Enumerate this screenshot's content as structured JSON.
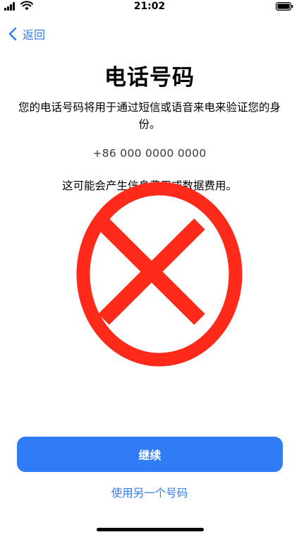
{
  "status_bar": {
    "time": "21:02",
    "icons": [
      "cellular-signal-icon",
      "wifi-icon",
      "battery-icon"
    ]
  },
  "nav": {
    "back_label": "返回",
    "back_icon": "chevron-left-icon"
  },
  "page": {
    "title": "电话号码",
    "description": "您的电话号码将用于通过短信或语音来电来验证您的身份。",
    "phone_number": "+86 000 0000 0000",
    "note": "这可能会产生信息费用或数据费用。"
  },
  "overlay": {
    "icon": "red-x-circle-icon",
    "color": "#ff2a1a"
  },
  "actions": {
    "continue_label": "继续",
    "use_other_label": "使用另一个号码"
  },
  "colors": {
    "accent": "#2f7cf6",
    "overlay_red": "#ff2a1a"
  }
}
